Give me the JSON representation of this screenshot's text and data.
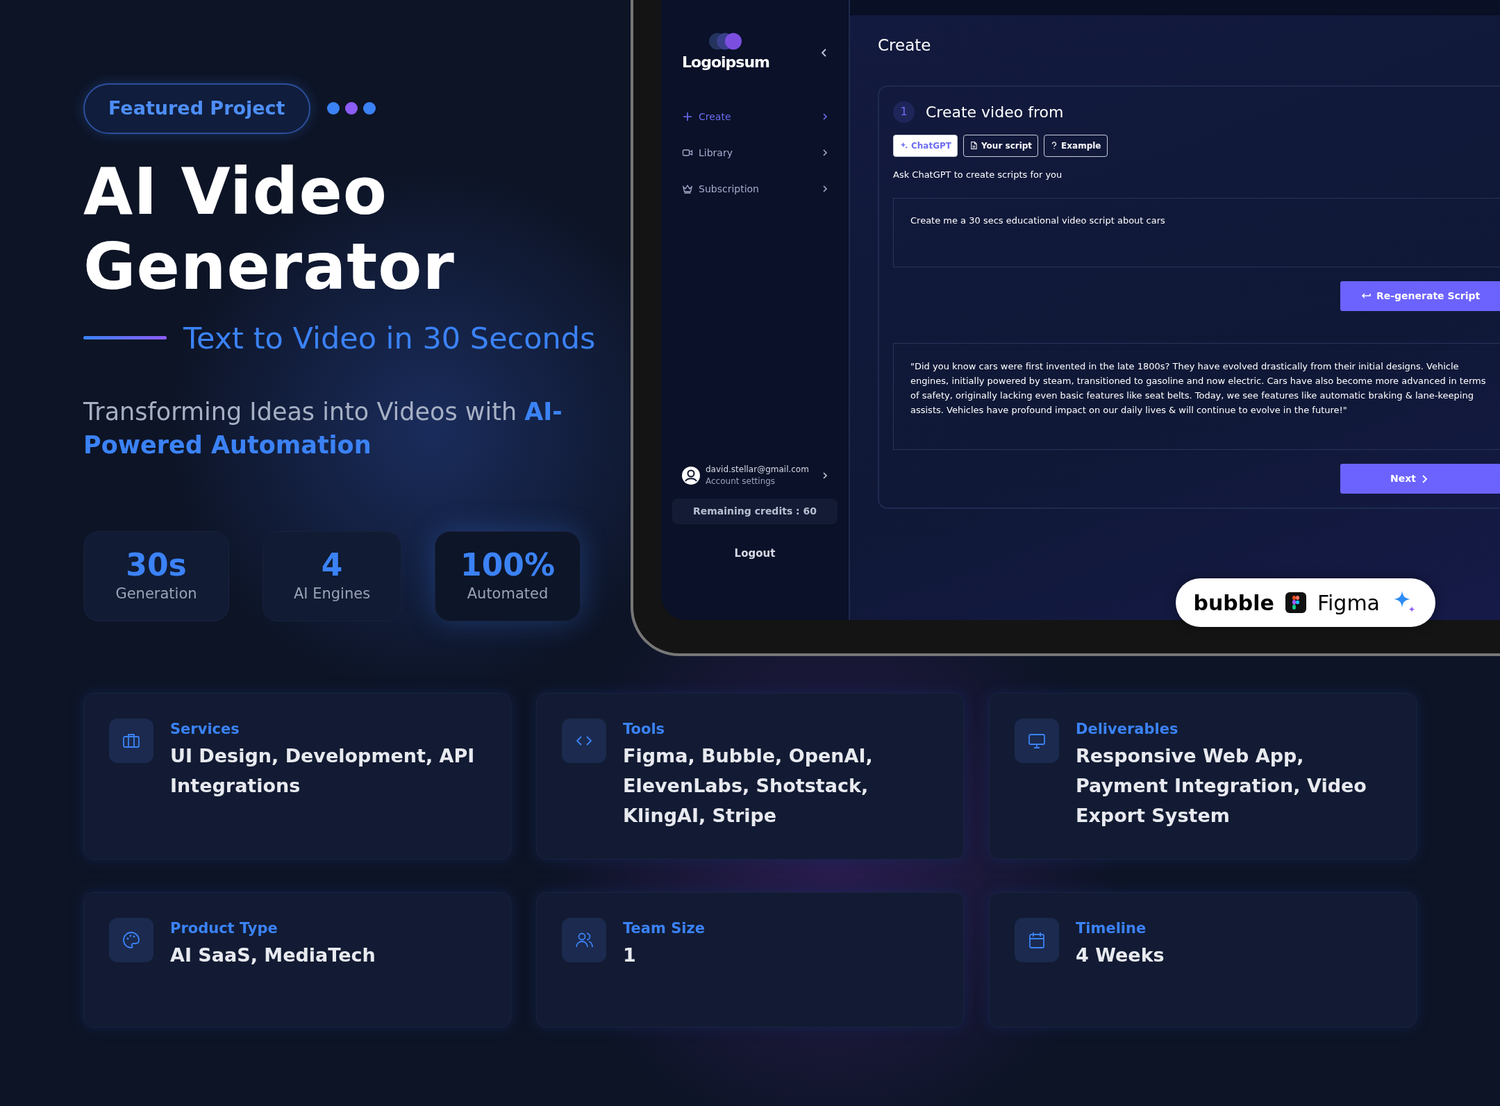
{
  "hero": {
    "badge": "Featured Project",
    "dots": [
      {
        "color": "#3b82f6"
      },
      {
        "color": "#8b5cf6"
      },
      {
        "color": "#3b82f6"
      }
    ],
    "title": "AI Video Generator",
    "subtitle": "Text to Video in 30 Seconds",
    "description": "Transforming Ideas into Videos with **AI-Powered Automation**",
    "stats": [
      {
        "value": "30s",
        "label": "Generation",
        "highlighted": false
      },
      {
        "value": "4",
        "label": "AI Engines",
        "highlighted": false
      },
      {
        "value": "100%",
        "label": "Automated",
        "highlighted": true
      }
    ]
  },
  "app": {
    "logo": "Logoipsum",
    "nav": [
      {
        "label": "Create",
        "selected": true
      },
      {
        "label": "Library",
        "selected": false
      },
      {
        "label": "Subscription",
        "selected": false
      }
    ],
    "account": {
      "email": "david.stellar@gmail.com",
      "link": "Account settings"
    },
    "credits": "Remaining credits : 60",
    "logout": "Logout",
    "page_title": "Create",
    "step": {
      "number": "1",
      "title": "Create video from"
    },
    "tabs": [
      {
        "label": "ChatGPT",
        "selected": true
      },
      {
        "label": "Your script",
        "selected": false
      },
      {
        "label": "Example",
        "selected": false
      }
    ],
    "hint": "Ask ChatGPT to create scripts for you",
    "prompt": "Create me a 30 secs educational video script about cars",
    "regenerate_button": "Re-generate Script",
    "script": "\"Did you know cars were first invented in the late 1800s? They have evolved drastically from their initial designs. Vehicle engines, initially powered by steam, transitioned to gasoline and now electric. Cars have also become more advanced in terms of safety, originally lacking even basic features like seat belts. Today, we see features like automatic braking & lane-keeping assists. Vehicles have profound impact on our daily lives & will continue to evolve in the future!\"",
    "next_button": "Next"
  },
  "tools_badge": [
    "bubble",
    "Figma"
  ],
  "details": [
    {
      "label": "Services",
      "value": "UI Design, Development, API Integrations"
    },
    {
      "label": "Tools",
      "value": "Figma, Bubble, OpenAI, ElevenLabs, Shotstack,  KlingAI, Stripe"
    },
    {
      "label": "Deliverables",
      "value": "Responsive Web App, Payment Integration, Video Export System"
    },
    {
      "label": "Product Type",
      "value": "AI SaaS, MediaTech"
    },
    {
      "label": "Team Size",
      "value": "1"
    },
    {
      "label": "Timeline",
      "value": "4 Weeks"
    }
  ]
}
